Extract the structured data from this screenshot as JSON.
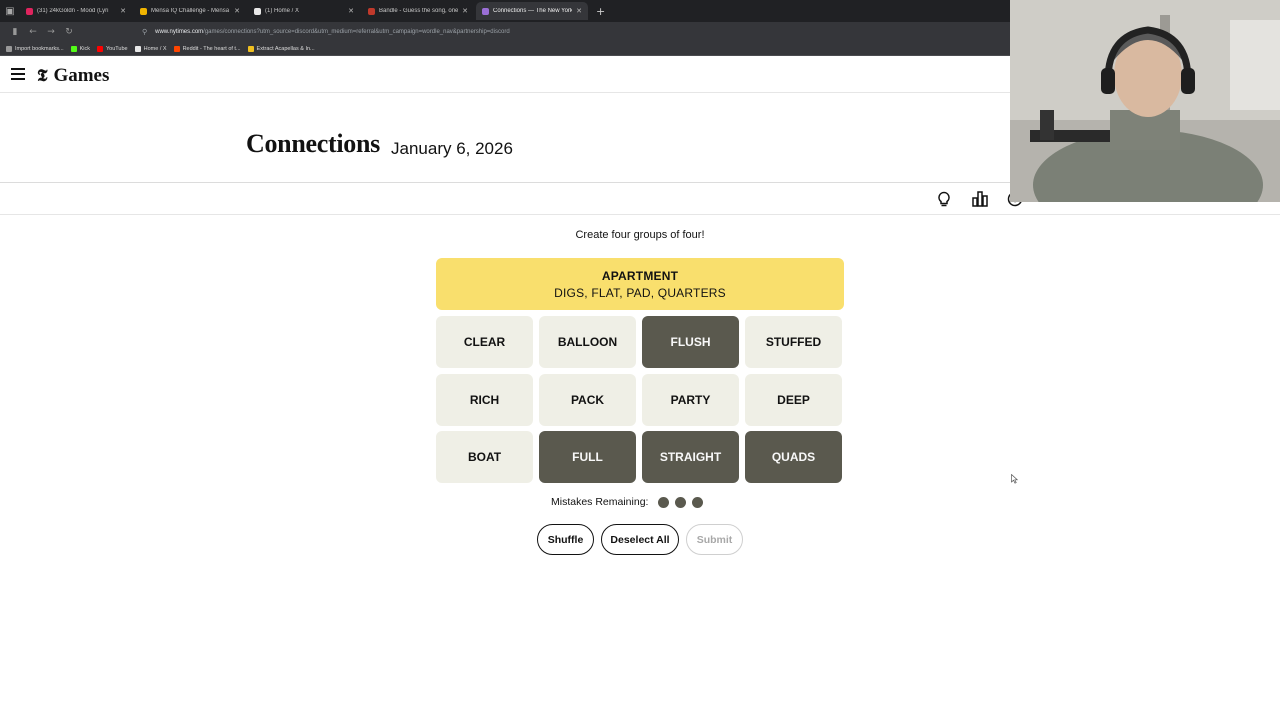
{
  "browser": {
    "tabs": [
      {
        "title": "(31) 24kGoldn - Mood (Lyri",
        "icon_color": "#e0245e",
        "active": false
      },
      {
        "title": "Mensa IQ Challenge - Mensa In",
        "icon_color": "#f0b400",
        "active": false
      },
      {
        "title": "(1) Home / X",
        "icon_color": "#e8e8e8",
        "active": false
      },
      {
        "title": "Bandle - Guess the song, one in",
        "icon_color": "#c0392b",
        "active": false
      },
      {
        "title": "Connections — The New York T",
        "icon_color": "#9b6fd6",
        "active": true
      }
    ],
    "url_host": "www.nytimes.com",
    "url_path": "/games/connections?utm_source=discord&utm_medium=referral&utm_campaign=wordle_nav&partnership=discord",
    "bookmarks": [
      {
        "label": "Import bookmarks...",
        "icon_color": "#999999"
      },
      {
        "label": "Kick",
        "icon_color": "#53fc18"
      },
      {
        "label": "YouTube",
        "icon_color": "#ff0000"
      },
      {
        "label": "Home / X",
        "icon_color": "#e8e8e8"
      },
      {
        "label": "Reddit - The heart of t...",
        "icon_color": "#ff4500"
      },
      {
        "label": "Extract Acapellas & In...",
        "icon_color": "#f0c020"
      }
    ]
  },
  "header": {
    "logo_mark": "𝕿",
    "logo_text": "Games"
  },
  "game": {
    "title": "Connections",
    "date": "January 6, 2026",
    "prompt": "Create four groups of four!",
    "solved_groups": [
      {
        "name": "APARTMENT",
        "words": "DIGS, FLAT, PAD, QUARTERS",
        "color": "#f9df6d"
      }
    ],
    "cards": [
      {
        "word": "CLEAR",
        "selected": false
      },
      {
        "word": "BALLOON",
        "selected": false
      },
      {
        "word": "FLUSH",
        "selected": true
      },
      {
        "word": "STUFFED",
        "selected": false
      },
      {
        "word": "RICH",
        "selected": false
      },
      {
        "word": "PACK",
        "selected": false
      },
      {
        "word": "PARTY",
        "selected": false
      },
      {
        "word": "DEEP",
        "selected": false
      },
      {
        "word": "BOAT",
        "selected": false
      },
      {
        "word": "FULL",
        "selected": true
      },
      {
        "word": "STRAIGHT",
        "selected": true
      },
      {
        "word": "QUADS",
        "selected": true
      }
    ],
    "mistakes_label": "Mistakes Remaining:",
    "mistakes_remaining": 3,
    "buttons": {
      "shuffle": "Shuffle",
      "deselect": "Deselect All",
      "submit": "Submit"
    }
  },
  "colors": {
    "card_bg": "#efefe6",
    "card_selected": "#5a594e",
    "yellow_group": "#f9df6d"
  },
  "icons": [
    "hamburger-icon",
    "lightbulb-icon",
    "stats-icon",
    "settings-icon"
  ]
}
